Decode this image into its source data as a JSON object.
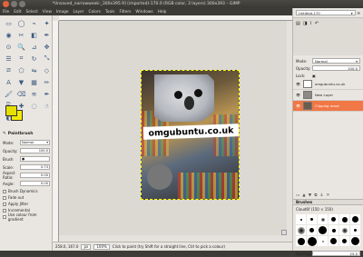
{
  "window": {
    "title": "*Unsaved_narrowweek-_300x395.9] (imported)-170.0 (RGB color, 3 layers) 300x393 – GIMP"
  },
  "menu": [
    "File",
    "Edit",
    "Select",
    "View",
    "Image",
    "Layer",
    "Colors",
    "Tools",
    "Filters",
    "Windows",
    "Help"
  ],
  "tool_icons": [
    "rect-select-icon",
    "ellipse-select-icon",
    "free-select-icon",
    "fuzzy-select-icon",
    "color-select-icon",
    "scissors-icon",
    "foreground-select-icon",
    "paths-icon",
    "color-picker-icon",
    "zoom-icon",
    "measure-icon",
    "move-icon",
    "align-icon",
    "crop-icon",
    "rotate-icon",
    "scale-icon",
    "shear-icon",
    "perspective-icon",
    "flip-icon",
    "cage-icon",
    "text-icon",
    "bucket-fill-icon",
    "blend-icon",
    "pencil-icon",
    "paintbrush-icon",
    "eraser-icon",
    "airbrush-icon",
    "ink-icon",
    "clone-icon",
    "heal-icon",
    "blur-icon",
    "smudge-icon",
    "dodge-icon"
  ],
  "colors": {
    "foreground": "#e5e000",
    "background": "#f2ea04",
    "accent": "#f07746"
  },
  "tool_options": {
    "title": "Paintbrush",
    "mode_label": "Mode:",
    "mode_value": "Normal",
    "opacity_label": "Opacity:",
    "opacity_value": "100.0",
    "brush_label": "Brush",
    "scale_label": "Scale:",
    "scale_value": "0.73",
    "aspect_label": "Aspect Ratio:",
    "aspect_value": "0.00",
    "angle_label": "Angle:",
    "angle_value": "0.00",
    "checks": [
      "Brush Dynamics",
      "Fade out",
      "Apply Jitter",
      "Incremental",
      "Use colour from gradient"
    ]
  },
  "canvas": {
    "logo_text": "omgubuntu.co.uk"
  },
  "status": {
    "units": "px",
    "zoom": "100%",
    "message": "Click to paint (try Shift for a straight line, Ctrl to pick a colour)",
    "coords": "258.0, 167.0"
  },
  "dock": {
    "image_select": "Untitled-170",
    "mode_label": "Mode:",
    "mode_value": "Normal",
    "opacity_label": "Opacity:",
    "opacity_value": "100.0",
    "lock_label": "Lock:",
    "layers_title": "Layers",
    "layers": [
      {
        "name": "omgubuntu.co.uk",
        "selected": false
      },
      {
        "name": "New Layer",
        "selected": false
      },
      {
        "name": "Clipping mask",
        "selected": true
      }
    ],
    "brushes_title": "Brushes",
    "brush_name": "Cloud6f (150 × 150)",
    "spacing_label": "Spacing:",
    "spacing_value": "25.0"
  }
}
